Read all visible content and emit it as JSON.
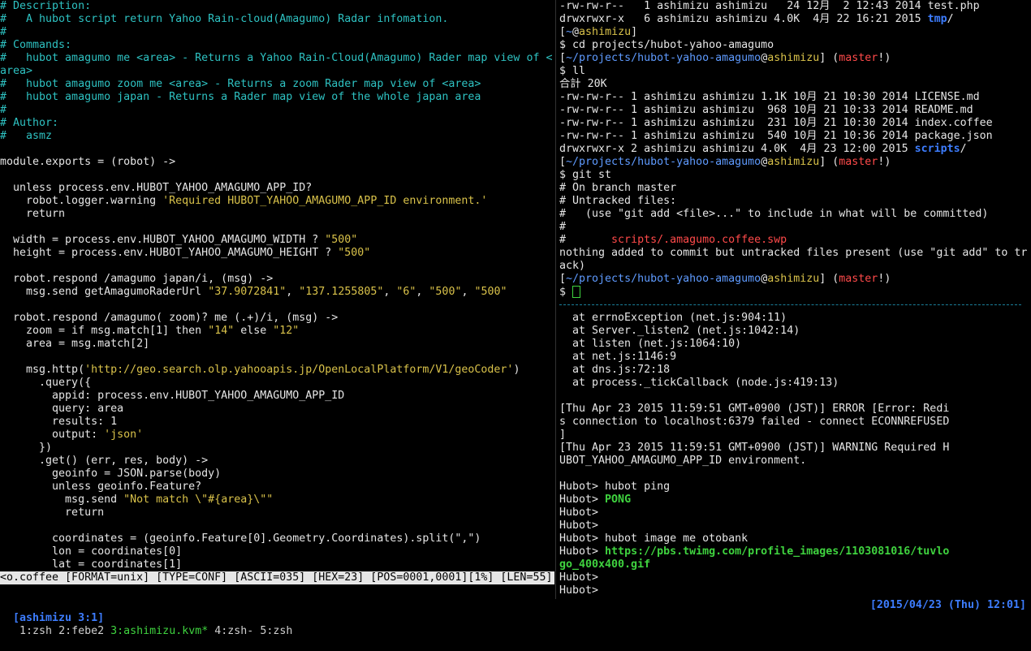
{
  "editor": {
    "lines": [
      {
        "segs": [
          {
            "t": "# Description:",
            "c": "cyan"
          }
        ]
      },
      {
        "segs": [
          {
            "t": "#   A hubot script return Yahoo Rain-cloud(Amagumo) Radar infomation.",
            "c": "cyan"
          }
        ]
      },
      {
        "segs": [
          {
            "t": "#",
            "c": "cyan"
          }
        ]
      },
      {
        "segs": [
          {
            "t": "# Commands:",
            "c": "cyan"
          }
        ]
      },
      {
        "segs": [
          {
            "t": "#   hubot amagumo me <area> - Returns a Yahoo Rain-Cloud(Amagumo) Rader map view of <",
            "c": "cyan"
          }
        ]
      },
      {
        "segs": [
          {
            "t": "area>",
            "c": "cyan"
          }
        ]
      },
      {
        "segs": [
          {
            "t": "#   hubot amagumo zoom me <area> - Returns a zoom Rader map view of <area>",
            "c": "cyan"
          }
        ]
      },
      {
        "segs": [
          {
            "t": "#   hubot amagumo japan - Returns a Rader map view of the whole japan area",
            "c": "cyan"
          }
        ]
      },
      {
        "segs": [
          {
            "t": "#",
            "c": "cyan"
          }
        ]
      },
      {
        "segs": [
          {
            "t": "# Author:",
            "c": "cyan"
          }
        ]
      },
      {
        "segs": [
          {
            "t": "#   asmz",
            "c": "cyan"
          }
        ]
      },
      {
        "segs": [
          {
            "t": ""
          }
        ]
      },
      {
        "segs": [
          {
            "t": "module.exports = (robot) ->"
          }
        ]
      },
      {
        "segs": [
          {
            "t": ""
          }
        ]
      },
      {
        "segs": [
          {
            "t": "  unless process.env.HUBOT_YAHOO_AMAGUMO_APP_ID?"
          }
        ]
      },
      {
        "segs": [
          {
            "t": "    robot.logger.warning "
          },
          {
            "t": "'Required HUBOT_YAHOO_AMAGUMO_APP_ID environment.'",
            "c": "yellow"
          }
        ]
      },
      {
        "segs": [
          {
            "t": "    return"
          }
        ]
      },
      {
        "segs": [
          {
            "t": ""
          }
        ]
      },
      {
        "segs": [
          {
            "t": "  width = process.env.HUBOT_YAHOO_AMAGUMO_WIDTH ? "
          },
          {
            "t": "\"500\"",
            "c": "yellow"
          }
        ]
      },
      {
        "segs": [
          {
            "t": "  height = process.env.HUBOT_YAHOO_AMAGUMO_HEIGHT ? "
          },
          {
            "t": "\"500\"",
            "c": "yellow"
          }
        ]
      },
      {
        "segs": [
          {
            "t": ""
          }
        ]
      },
      {
        "segs": [
          {
            "t": "  robot.respond /amagumo japan/i, (msg) ->"
          }
        ]
      },
      {
        "segs": [
          {
            "t": "    msg.send getAmagumoRaderUrl "
          },
          {
            "t": "\"37.9072841\"",
            "c": "yellow"
          },
          {
            "t": ", "
          },
          {
            "t": "\"137.1255805\"",
            "c": "yellow"
          },
          {
            "t": ", "
          },
          {
            "t": "\"6\"",
            "c": "yellow"
          },
          {
            "t": ", "
          },
          {
            "t": "\"500\"",
            "c": "yellow"
          },
          {
            "t": ", "
          },
          {
            "t": "\"500\"",
            "c": "yellow"
          }
        ]
      },
      {
        "segs": [
          {
            "t": ""
          }
        ]
      },
      {
        "segs": [
          {
            "t": "  robot.respond /amagumo( zoom)? me (.+)/i, (msg) ->"
          }
        ]
      },
      {
        "segs": [
          {
            "t": "    zoom = if msg.match[1] then "
          },
          {
            "t": "\"14\"",
            "c": "yellow"
          },
          {
            "t": " else "
          },
          {
            "t": "\"12\"",
            "c": "yellow"
          }
        ]
      },
      {
        "segs": [
          {
            "t": "    area = msg.match[2]"
          }
        ]
      },
      {
        "segs": [
          {
            "t": ""
          }
        ]
      },
      {
        "segs": [
          {
            "t": "    msg.http("
          },
          {
            "t": "'http://geo.search.olp.yahooapis.jp/OpenLocalPlatform/V1/geoCoder'",
            "c": "yellow"
          },
          {
            "t": ")"
          }
        ]
      },
      {
        "segs": [
          {
            "t": "      .query({"
          }
        ]
      },
      {
        "segs": [
          {
            "t": "        appid: process.env.HUBOT_YAHOO_AMAGUMO_APP_ID"
          }
        ]
      },
      {
        "segs": [
          {
            "t": "        query: area"
          }
        ]
      },
      {
        "segs": [
          {
            "t": "        results: 1"
          }
        ]
      },
      {
        "segs": [
          {
            "t": "        output: "
          },
          {
            "t": "'json'",
            "c": "yellow"
          }
        ]
      },
      {
        "segs": [
          {
            "t": "      })"
          }
        ]
      },
      {
        "segs": [
          {
            "t": "      .get() (err, res, body) ->"
          }
        ]
      },
      {
        "segs": [
          {
            "t": "        geoinfo = JSON.parse(body)"
          }
        ]
      },
      {
        "segs": [
          {
            "t": "        unless geoinfo.Feature?"
          }
        ]
      },
      {
        "segs": [
          {
            "t": "          msg.send "
          },
          {
            "t": "\"Not match \\\"#{area}\\\"\"",
            "c": "yellow"
          }
        ]
      },
      {
        "segs": [
          {
            "t": "          return"
          }
        ]
      },
      {
        "segs": [
          {
            "t": ""
          }
        ]
      },
      {
        "segs": [
          {
            "t": "        coordinates = (geoinfo.Feature[0].Geometry.Coordinates).split(\",\")"
          }
        ]
      },
      {
        "segs": [
          {
            "t": "        lon = coordinates[0]"
          }
        ]
      },
      {
        "segs": [
          {
            "t": "        lat = coordinates[1]"
          }
        ]
      }
    ],
    "statusline": "<o.coffee [FORMAT=unix] [TYPE=CONF] [ASCII=035] [HEX=23] [POS=0001,0001][1%] [LEN=55]"
  },
  "shell": {
    "lines": [
      {
        "segs": [
          {
            "t": "-rw-rw-r--   1 ashimizu ashimizu   24 12月  2 12:43 2014 test.php"
          }
        ]
      },
      {
        "segs": [
          {
            "t": "drwxrwxr-x   6 ashimizu ashimizu 4.0K  4月 22 16:21 2015 "
          },
          {
            "t": "tmp",
            "c": "bblue"
          },
          {
            "t": "/"
          }
        ]
      },
      {
        "segs": [
          {
            "t": "["
          },
          {
            "t": "~",
            "c": "blue"
          },
          {
            "t": "@"
          },
          {
            "t": "ashimizu",
            "c": "yellow"
          },
          {
            "t": "]"
          }
        ]
      },
      {
        "segs": [
          {
            "t": "$ cd projects/hubot-yahoo-amagumo"
          }
        ]
      },
      {
        "segs": [
          {
            "t": "["
          },
          {
            "t": "~/projects/hubot-yahoo-amagumo",
            "c": "blue"
          },
          {
            "t": "@"
          },
          {
            "t": "ashimizu",
            "c": "yellow"
          },
          {
            "t": "] ("
          },
          {
            "t": "master",
            "c": "red"
          },
          {
            "t": "!)"
          }
        ]
      },
      {
        "segs": [
          {
            "t": "$ ll"
          }
        ]
      },
      {
        "segs": [
          {
            "t": "合計 20K"
          }
        ]
      },
      {
        "segs": [
          {
            "t": "-rw-rw-r-- 1 ashimizu ashimizu 1.1K 10月 21 10:30 2014 LICENSE.md"
          }
        ]
      },
      {
        "segs": [
          {
            "t": "-rw-rw-r-- 1 ashimizu ashimizu  968 10月 21 10:33 2014 README.md"
          }
        ]
      },
      {
        "segs": [
          {
            "t": "-rw-rw-r-- 1 ashimizu ashimizu  231 10月 21 10:30 2014 index.coffee"
          }
        ]
      },
      {
        "segs": [
          {
            "t": "-rw-rw-r-- 1 ashimizu ashimizu  540 10月 21 10:36 2014 package.json"
          }
        ]
      },
      {
        "segs": [
          {
            "t": "drwxrwxr-x 2 ashimizu ashimizu 4.0K  4月 23 12:00 2015 "
          },
          {
            "t": "scripts",
            "c": "bblue"
          },
          {
            "t": "/"
          }
        ]
      },
      {
        "segs": [
          {
            "t": "["
          },
          {
            "t": "~/projects/hubot-yahoo-amagumo",
            "c": "blue"
          },
          {
            "t": "@"
          },
          {
            "t": "ashimizu",
            "c": "yellow"
          },
          {
            "t": "] ("
          },
          {
            "t": "master",
            "c": "red"
          },
          {
            "t": "!)"
          }
        ]
      },
      {
        "segs": [
          {
            "t": "$ git st"
          }
        ]
      },
      {
        "segs": [
          {
            "t": "# On branch master"
          }
        ]
      },
      {
        "segs": [
          {
            "t": "# Untracked files:"
          }
        ]
      },
      {
        "segs": [
          {
            "t": "#   (use \"git add <file>...\" to include in what will be committed)"
          }
        ]
      },
      {
        "segs": [
          {
            "t": "#"
          }
        ]
      },
      {
        "segs": [
          {
            "t": "#       "
          },
          {
            "t": "scripts/.amagumo.coffee.swp",
            "c": "red"
          }
        ]
      },
      {
        "segs": [
          {
            "t": "nothing added to commit but untracked files present (use \"git add\" to tr"
          }
        ]
      },
      {
        "segs": [
          {
            "t": "ack)"
          }
        ]
      },
      {
        "segs": [
          {
            "t": "["
          },
          {
            "t": "~/projects/hubot-yahoo-amagumo",
            "c": "blue"
          },
          {
            "t": "@"
          },
          {
            "t": "ashimizu",
            "c": "yellow"
          },
          {
            "t": "] ("
          },
          {
            "t": "master",
            "c": "red"
          },
          {
            "t": "!)"
          }
        ]
      },
      {
        "segs": [
          {
            "t": "$ "
          }
        ],
        "cursor": true
      },
      {
        "hr": true
      },
      {
        "segs": [
          {
            "t": "  at errnoException (net.js:904:11)"
          }
        ]
      },
      {
        "segs": [
          {
            "t": "  at Server._listen2 (net.js:1042:14)"
          }
        ]
      },
      {
        "segs": [
          {
            "t": "  at listen (net.js:1064:10)"
          }
        ]
      },
      {
        "segs": [
          {
            "t": "  at net.js:1146:9"
          }
        ]
      },
      {
        "segs": [
          {
            "t": "  at dns.js:72:18"
          }
        ]
      },
      {
        "segs": [
          {
            "t": "  at process._tickCallback (node.js:419:13)"
          }
        ]
      },
      {
        "segs": [
          {
            "t": ""
          }
        ]
      },
      {
        "segs": [
          {
            "t": "[Thu Apr 23 2015 11:59:51 GMT+0900 (JST)] ERROR [Error: Redi"
          }
        ]
      },
      {
        "segs": [
          {
            "t": "s connection to localhost:6379 failed - connect ECONNREFUSED"
          }
        ]
      },
      {
        "segs": [
          {
            "t": "]"
          }
        ]
      },
      {
        "segs": [
          {
            "t": "[Thu Apr 23 2015 11:59:51 GMT+0900 (JST)] WARNING Required H"
          }
        ]
      },
      {
        "segs": [
          {
            "t": "UBOT_YAHOO_AMAGUMO_APP_ID environment."
          }
        ]
      },
      {
        "segs": [
          {
            "t": ""
          }
        ]
      },
      {
        "segs": [
          {
            "t": "Hubot> hubot ping"
          }
        ]
      },
      {
        "segs": [
          {
            "t": "Hubot> "
          },
          {
            "t": "PONG",
            "c": "green"
          }
        ]
      },
      {
        "segs": [
          {
            "t": "Hubot>"
          }
        ]
      },
      {
        "segs": [
          {
            "t": "Hubot>"
          }
        ]
      },
      {
        "segs": [
          {
            "t": "Hubot> hubot image me otobank"
          }
        ]
      },
      {
        "segs": [
          {
            "t": "Hubot> "
          },
          {
            "t": "https://pbs.twimg.com/profile_images/1103081016/tuvlo",
            "c": "green"
          }
        ]
      },
      {
        "segs": [
          {
            "t": "go_400x400.gif",
            "c": "green"
          }
        ]
      },
      {
        "segs": [
          {
            "t": "Hubot>"
          }
        ]
      },
      {
        "segs": [
          {
            "t": "Hubot>"
          }
        ]
      }
    ]
  },
  "tmux": {
    "session": "[ashimizu 3:1]",
    "windows": [
      {
        "label": "1:zsh",
        "active": false
      },
      {
        "label": "2:febe2",
        "active": false
      },
      {
        "label": "3:ashimizu.kvm*",
        "active": true
      },
      {
        "label": "4:zsh-",
        "active": false
      },
      {
        "label": "5:zsh",
        "active": false
      }
    ],
    "clock": "[2015/04/23 (Thu) 12:01]"
  }
}
